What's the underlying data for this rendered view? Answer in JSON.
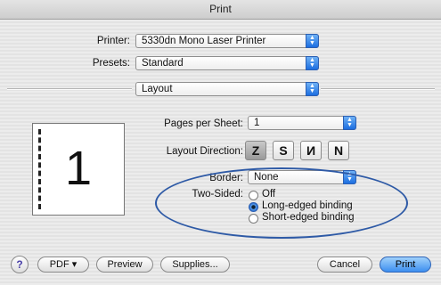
{
  "window": {
    "title": "Print"
  },
  "printer": {
    "label": "Printer:",
    "value": "5330dn Mono Laser Printer"
  },
  "presets": {
    "label": "Presets:",
    "value": "Standard"
  },
  "section": {
    "value": "Layout"
  },
  "preview": {
    "page_number": "1"
  },
  "layout": {
    "pages_per_sheet_label": "Pages per Sheet:",
    "pages_per_sheet_value": "1",
    "direction_label": "Layout Direction:",
    "directions": [
      "Z",
      "S",
      "N",
      "N"
    ],
    "selected_direction": 0,
    "border_label": "Border:",
    "border_value": "None",
    "two_sided_label": "Two-Sided:",
    "two_sided_options": [
      "Off",
      "Long-edged binding",
      "Short-edged binding"
    ],
    "two_sided_selected": 1
  },
  "buttons": {
    "help": "?",
    "pdf": "PDF ▾",
    "preview": "Preview",
    "supplies": "Supplies...",
    "cancel": "Cancel",
    "print": "Print"
  },
  "colors": {
    "accent": "#3d8ff0",
    "highlight_ellipse": "#2e5aa6"
  }
}
